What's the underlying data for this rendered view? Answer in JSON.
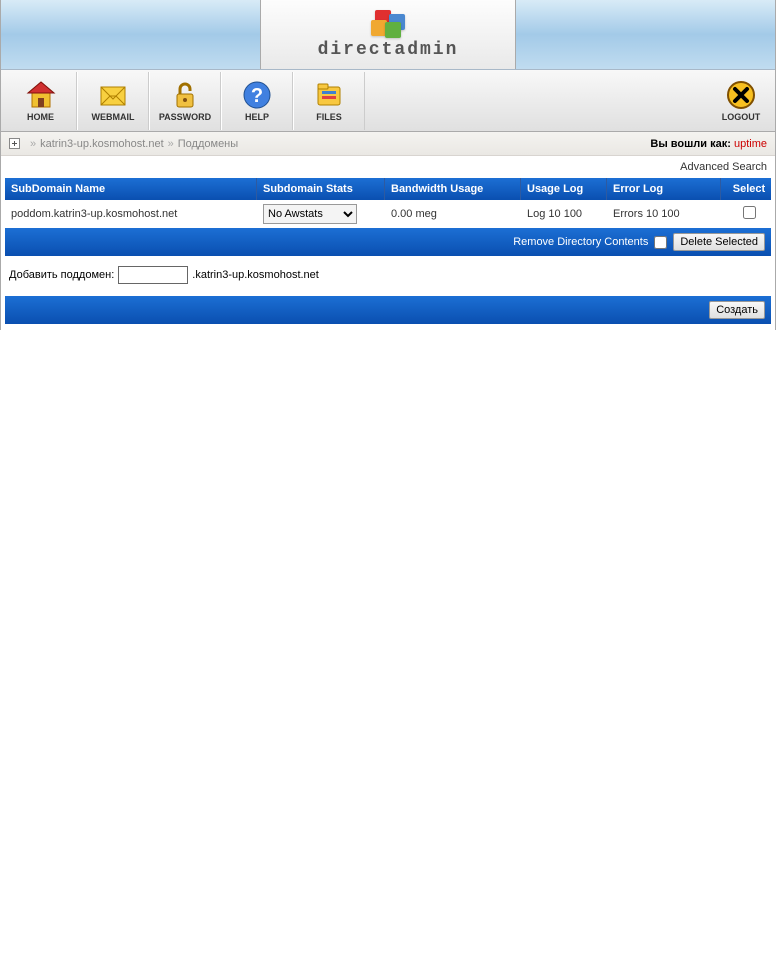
{
  "brand": "directadmin",
  "toolbar": {
    "home": "HOME",
    "webmail": "WEBMAIL",
    "password": "PASSWORD",
    "help": "HELP",
    "files": "FILES",
    "logout": "LOGOUT"
  },
  "breadcrumb": {
    "domain": "katrin3-up.kosmohost.net",
    "page": "Поддомены",
    "login_label": "Вы вошли как:",
    "user": "uptime"
  },
  "advanced_search": "Advanced Search",
  "table": {
    "headers": {
      "subdomain": "SubDomain Name",
      "stats": "Subdomain Stats",
      "bandwidth": "Bandwidth Usage",
      "usage_log": "Usage Log",
      "error_log": "Error Log",
      "select": "Select"
    },
    "rows": [
      {
        "name": "poddom.katrin3-up.kosmohost.net",
        "stats_option": "No Awstats",
        "bandwidth": "0.00 meg",
        "usage_log": "Log 10 100",
        "error_log": "Errors 10 100"
      }
    ],
    "footer": {
      "remove_label": "Remove Directory Contents",
      "delete_btn": "Delete Selected"
    }
  },
  "add": {
    "label": "Добавить поддомен:",
    "suffix": ".katrin3-up.kosmohost.net",
    "create_btn": "Создать"
  }
}
